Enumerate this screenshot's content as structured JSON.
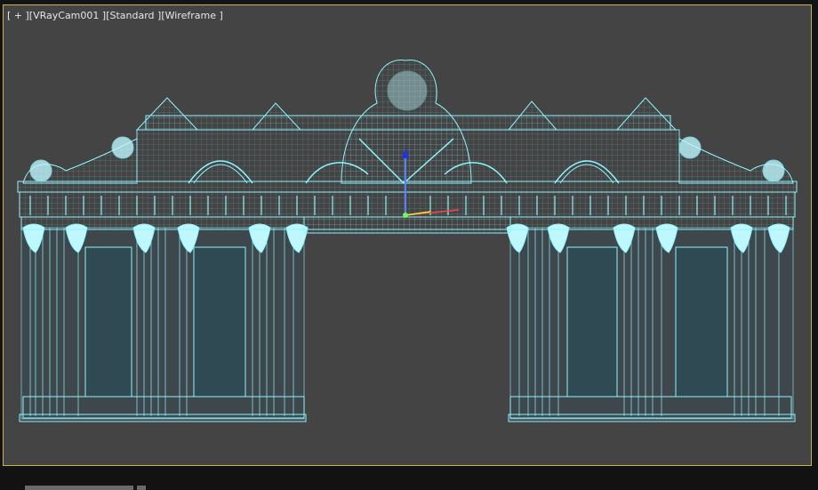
{
  "viewport": {
    "labels": [
      {
        "text": "[ + ]",
        "name": "viewport-menu-plus"
      },
      {
        "text": "[VRayCam001 ]",
        "name": "viewport-camera-label"
      },
      {
        "text": "[Standard ]",
        "name": "viewport-shading-standard"
      },
      {
        "text": "[Wireframe ]",
        "name": "viewport-display-wireframe"
      }
    ],
    "background_color": "#444444",
    "border_color": "#c9b24a",
    "wire_color": "#8ef4ff"
  },
  "scene": {
    "object": "arched-gateway-wireframe",
    "gizmo_axes": [
      "z",
      "x",
      "y"
    ]
  }
}
